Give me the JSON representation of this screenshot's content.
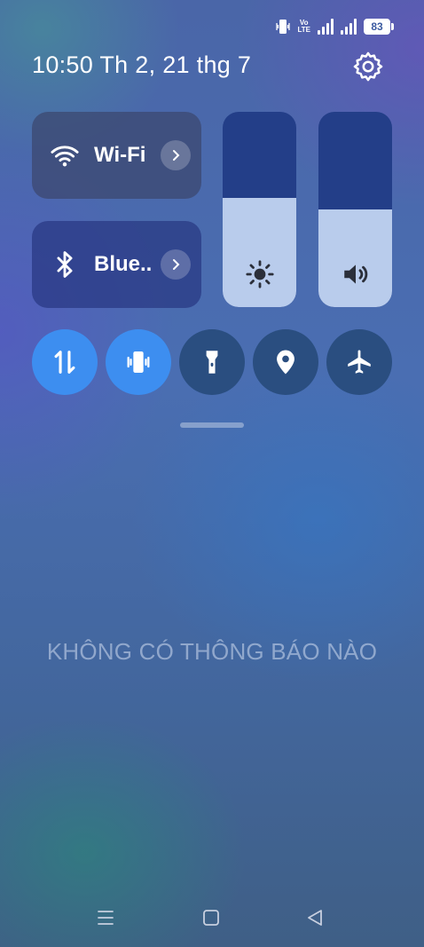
{
  "status_bar": {
    "icons": [
      "vibrate-icon",
      "volte-icon",
      "signal-icon",
      "signal-icon",
      "battery-icon"
    ],
    "volte_text": "Vo\nLTE",
    "battery_level": "83"
  },
  "header": {
    "datetime": "10:50 Th 2, 21 thg 7",
    "settings_icon": "gear-icon"
  },
  "tiles": {
    "wifi": {
      "label": "Wi-Fi",
      "icon": "wifi-icon"
    },
    "bluetooth": {
      "label": "Blue..",
      "icon": "bluetooth-icon"
    }
  },
  "sliders": {
    "brightness": {
      "icon": "sun-icon",
      "level": 0.56
    },
    "volume": {
      "icon": "speaker-icon",
      "level": 0.5
    }
  },
  "quick_toggles": [
    {
      "name": "mobile-data",
      "icon": "data-arrows-icon",
      "active": true
    },
    {
      "name": "vibrate",
      "icon": "vibrate-icon",
      "active": true
    },
    {
      "name": "flashlight",
      "icon": "flashlight-icon",
      "active": false
    },
    {
      "name": "location",
      "icon": "location-pin-icon",
      "active": false
    },
    {
      "name": "airplane-mode",
      "icon": "airplane-icon",
      "active": false
    }
  ],
  "notifications": {
    "empty_text": "KHÔNG CÓ THÔNG BÁO NÀO"
  },
  "navigation": [
    "menu-icon",
    "home-icon",
    "back-icon"
  ],
  "colors": {
    "toggle_active": "#3d8ef0",
    "toggle_inactive": "#2a4e80",
    "slider_fill": "#b9ccec",
    "slider_track": "#233e88"
  }
}
